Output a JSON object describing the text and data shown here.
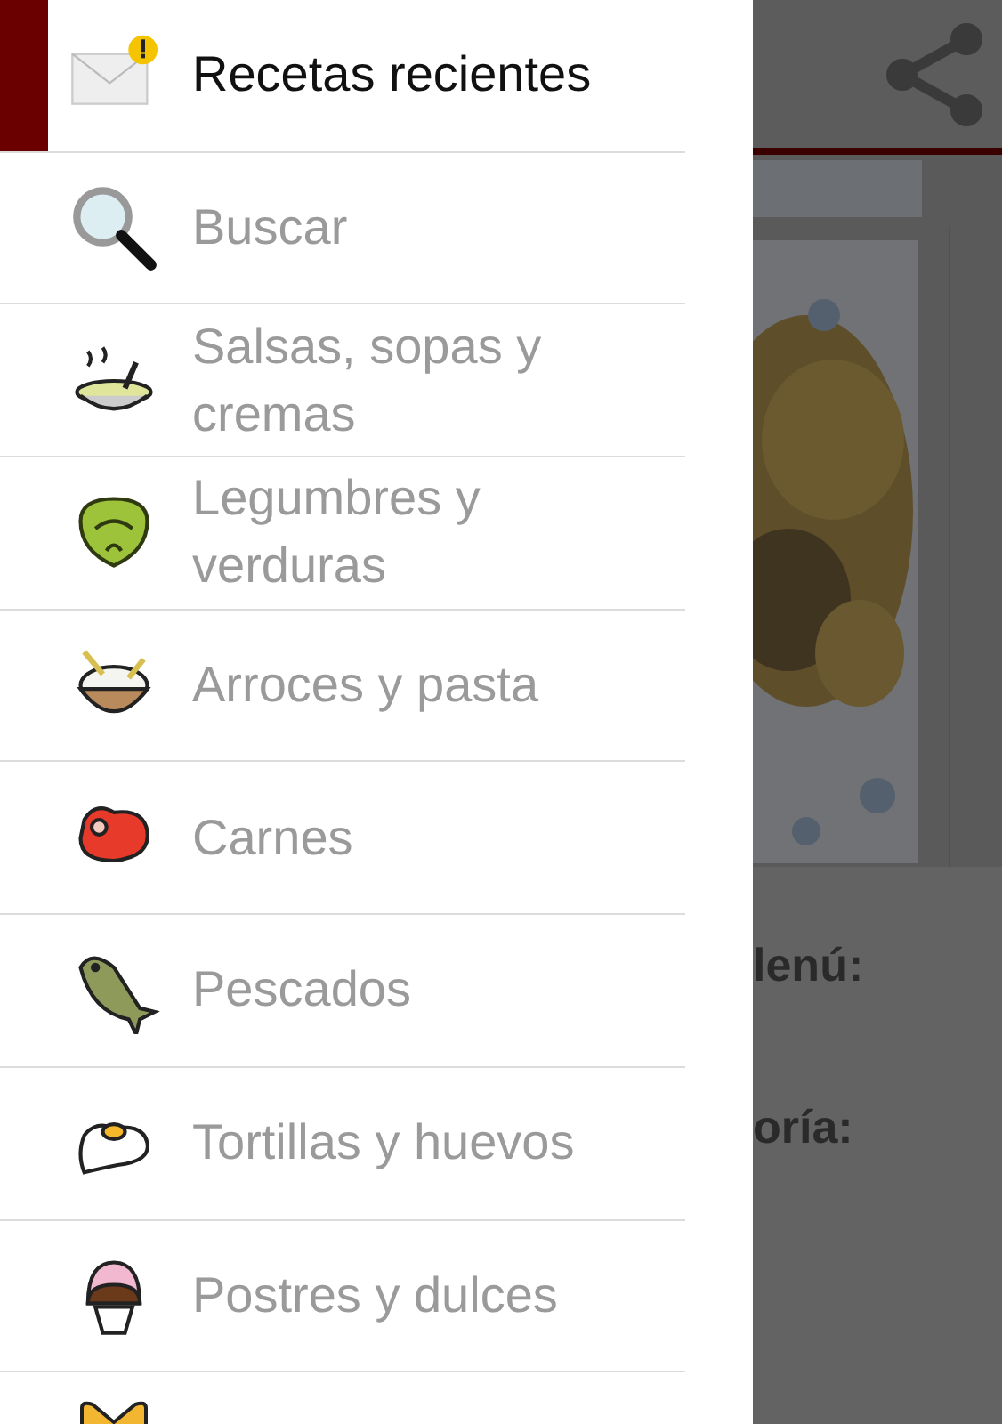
{
  "drawer": {
    "items": [
      {
        "kind": "mail",
        "label": "Recetas recientes",
        "selected": true
      },
      {
        "kind": "search",
        "label": "Buscar",
        "selected": false
      },
      {
        "kind": "soup",
        "label": "Salsas, sopas y cremas",
        "selected": false
      },
      {
        "kind": "lettuce",
        "label": "Legumbres y verduras",
        "selected": false
      },
      {
        "kind": "rice",
        "label": "Arroces y pasta",
        "selected": false
      },
      {
        "kind": "meat",
        "label": "Carnes",
        "selected": false
      },
      {
        "kind": "fish",
        "label": "Pescados",
        "selected": false
      },
      {
        "kind": "egg",
        "label": "Tortillas y huevos",
        "selected": false
      },
      {
        "kind": "cupcake",
        "label": "Postres y dulces",
        "selected": false
      },
      {
        "kind": "bow"
      }
    ]
  },
  "content": {
    "fields": [
      "lenú:",
      "oría:"
    ]
  }
}
